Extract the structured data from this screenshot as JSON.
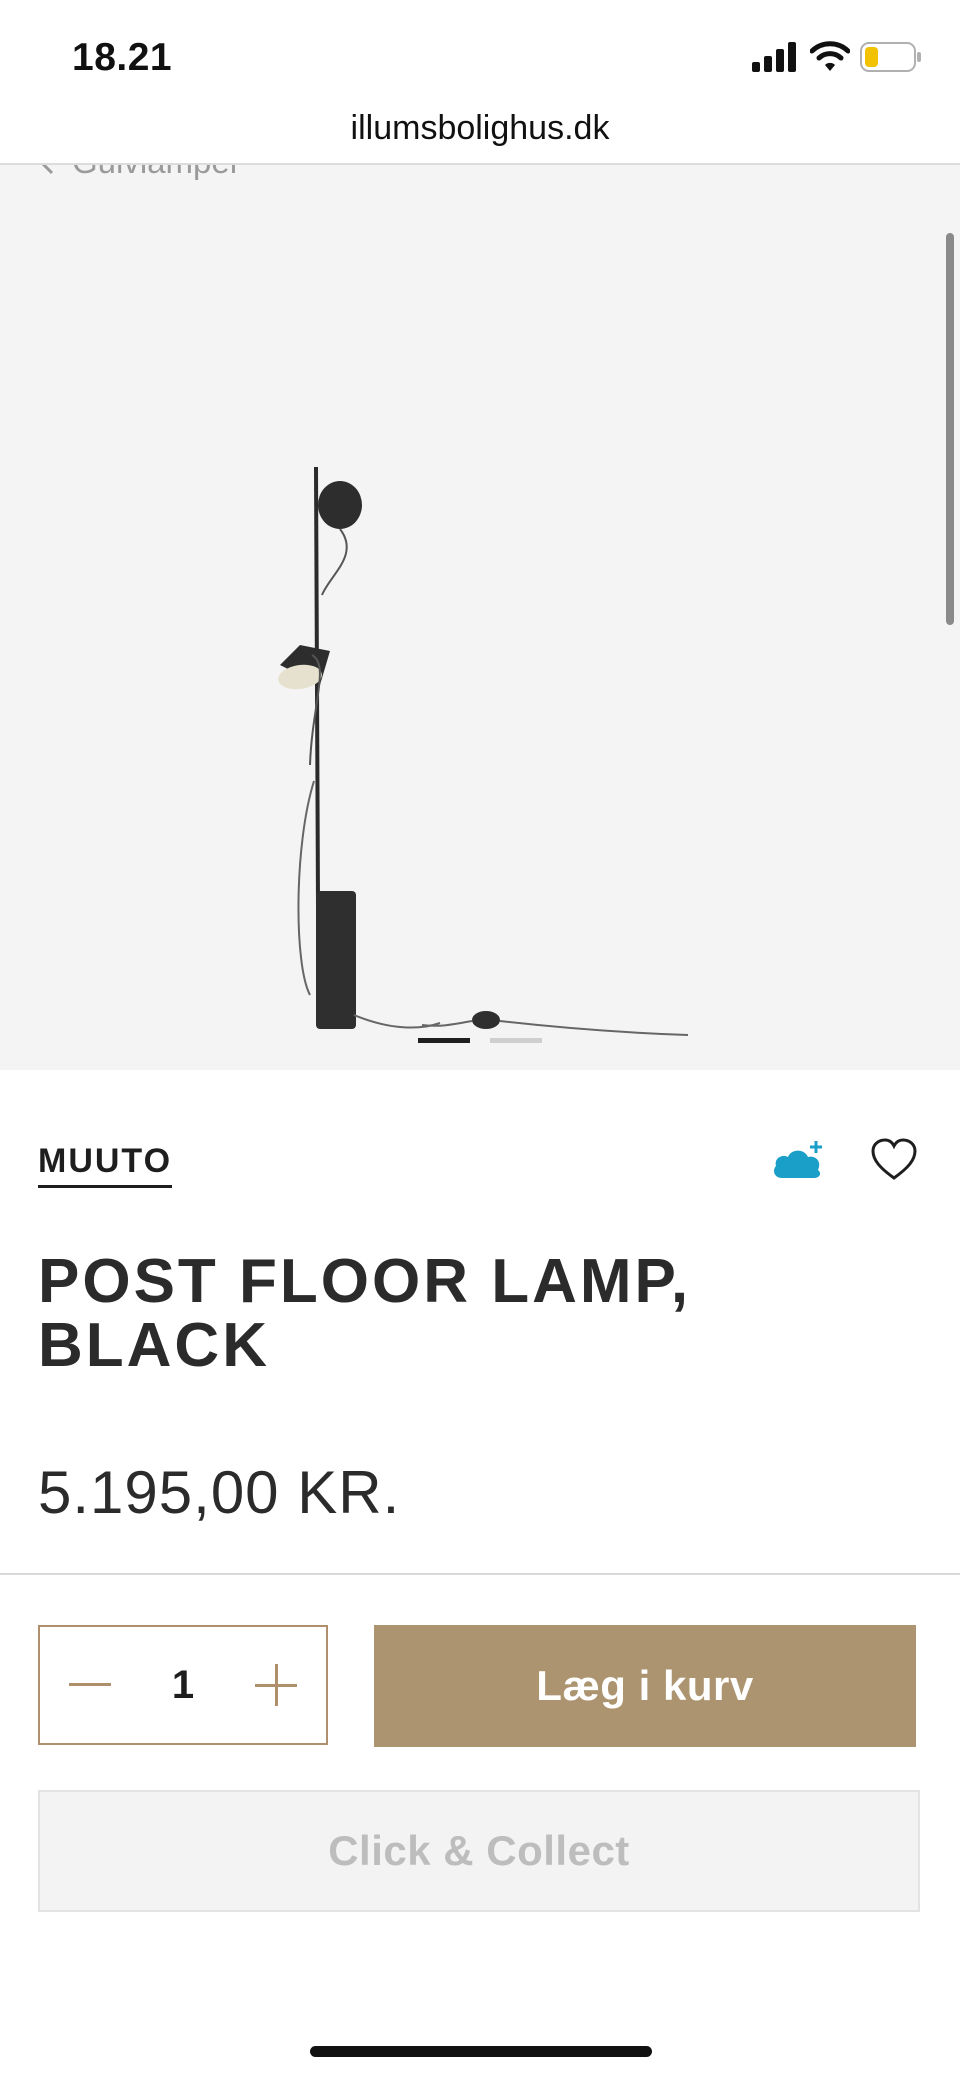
{
  "status_bar": {
    "time": "18.21",
    "signal_icon": "cellular-signal-icon",
    "wifi_icon": "wifi-icon",
    "battery_icon": "battery-low-icon",
    "battery_color": "#f2c200"
  },
  "browser": {
    "url": "illumsbolighus.dk"
  },
  "breadcrumb": {
    "label": "Gulvlamper",
    "icon": "chevron-left-icon"
  },
  "gallery": {
    "image_alt_icon": "post-floor-lamp-image",
    "slide_count": 2,
    "active_slide": 1
  },
  "product": {
    "brand": "MUUTO",
    "title": "POST FLOOR LAMP, BLACK",
    "price": "5.195,00 KR.",
    "save_icon": "cloud-plus-icon",
    "favorite_icon": "heart-icon"
  },
  "purchase": {
    "quantity": "1",
    "minus_icon": "minus-icon",
    "plus_icon": "plus-icon",
    "add_to_cart_label": "Læg i kurv",
    "click_collect_label": "Click & Collect"
  },
  "colors": {
    "accent": "#ad9470",
    "stepper_border": "#b08f6c",
    "cloud_icon": "#1a9fc9",
    "image_background": "#f4f4f4"
  }
}
